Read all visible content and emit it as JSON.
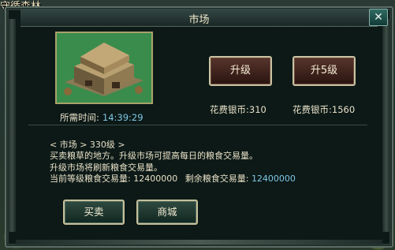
{
  "background": {
    "location_title": "守循森林"
  },
  "window": {
    "title": "市场",
    "close_icon": "close-icon"
  },
  "building": {
    "icon": "market-building-image"
  },
  "required_time": {
    "label": "所需时间:",
    "value": "14:39:29"
  },
  "upgrade": [
    {
      "label": "升级",
      "cost": "花费银币:310"
    },
    {
      "label": "升5级",
      "cost": "花费银币:1560"
    }
  ],
  "info": {
    "header": "< 市场 > 330级 >",
    "line1": "买卖粮草的地方。升级市场可提高每日的粮食交易量。",
    "line2": "升级市场将刷新粮食交易量。",
    "current_label": "当前等级粮食交易量:",
    "current_value": "12400000",
    "remaining_label": "剩余粮食交易量:",
    "remaining_value": "12400000"
  },
  "actions": {
    "buy_sell": "买卖",
    "shop": "商城"
  },
  "colors": {
    "accent_blue": "#7fc7e5",
    "text": "#e8e0c6",
    "panel": "#0c1917"
  }
}
